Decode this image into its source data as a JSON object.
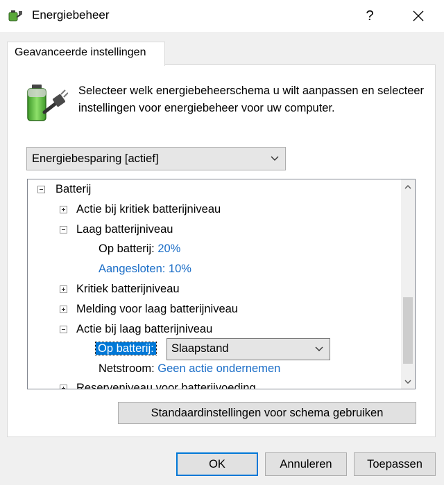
{
  "window": {
    "title": "Energiebeheer",
    "help_label": "?"
  },
  "tab": {
    "label": "Geavanceerde instellingen"
  },
  "intro": {
    "text": "Selecteer welk energiebeheerschema u wilt aanpassen en selecteer instellingen voor energiebeheer voor uw computer."
  },
  "scheme_select": {
    "value": "Energiebesparing [actief]"
  },
  "tree": {
    "battery": "Batterij",
    "critical_action": "Actie bij kritiek batterijniveau",
    "low_level": "Laag batterijniveau",
    "low_on_battery_label": "Op batterij:",
    "low_on_battery_value": "20%",
    "low_plugged_in": "Aangesloten: 10%",
    "critical_level": "Kritiek batterijniveau",
    "low_notification": "Melding voor laag batterijniveau",
    "low_action": "Actie bij laag batterijniveau",
    "action_on_battery_label": "Op batterij:",
    "action_on_battery_value": "Slaapstand",
    "action_plugged_label": "Netstroom:",
    "action_plugged_value": "Geen actie ondernemen",
    "reserve_level": "Reserveniveau voor batterijvoeding"
  },
  "buttons": {
    "restore": "Standaardinstellingen voor schema gebruiken",
    "ok": "OK",
    "cancel": "Annuleren",
    "apply": "Toepassen"
  },
  "colors": {
    "accent": "#0078d7",
    "link": "#1a6dc7"
  },
  "icons": {
    "app": "power-plug-battery-icon",
    "intro": "battery-plug-icon"
  }
}
